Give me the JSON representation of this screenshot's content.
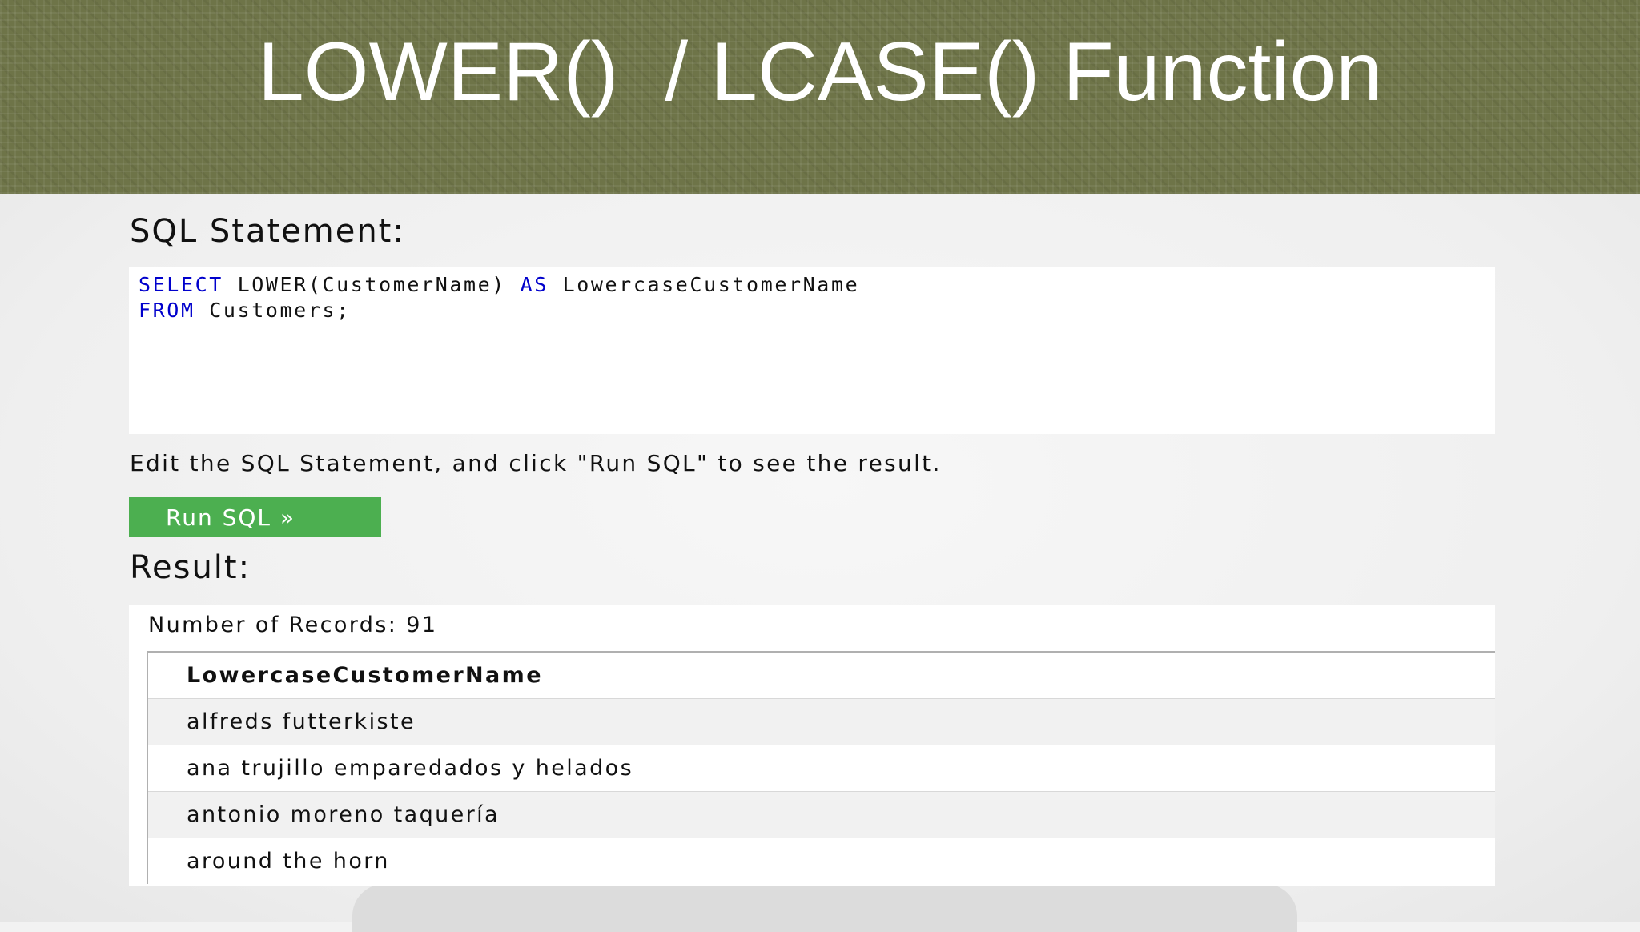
{
  "slide": {
    "title": "LOWER()  / LCASE() Function"
  },
  "sql_section": {
    "heading": "SQL Statement:",
    "code": {
      "line1": {
        "keyword1": "SELECT",
        "text1": " LOWER(CustomerName) ",
        "keyword2": "AS",
        "text2": " LowercaseCustomerName"
      },
      "line2": {
        "keyword": "FROM",
        "text": " Customers;"
      }
    },
    "instruction": "Edit the SQL Statement, and click \"Run SQL\" to see the result.",
    "run_button_label": "Run SQL »"
  },
  "result_section": {
    "heading": "Result:",
    "record_count": "Number of Records: 91",
    "table": {
      "column_header": "LowercaseCustomerName",
      "rows": [
        "alfreds futterkiste",
        "ana trujillo emparedados y helados",
        "antonio moreno taquería",
        "around the horn"
      ]
    }
  },
  "colors": {
    "title_bar": "#6e7448",
    "sql_keyword": "#0000cc",
    "run_button": "#4caf50"
  }
}
